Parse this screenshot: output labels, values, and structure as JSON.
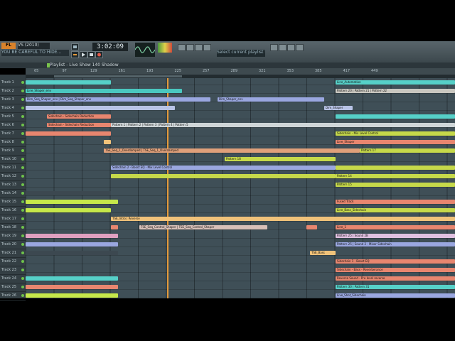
{
  "window": {
    "logo": "FL",
    "preset": "VS (2010)",
    "hint_text": "YOU BE CAREFUL TO HIDE...",
    "tempo_display": "3:02:09",
    "hint_panel": "Select current playlist track",
    "playlist_title": "Playlist - Live Show 140 Shadow"
  },
  "tracks": [
    "Track 1",
    "Track 2",
    "Track 3",
    "Track 4",
    "Track 5",
    "Track 6",
    "Track 7",
    "Track 8",
    "Track 9",
    "Track 10",
    "Track 11",
    "Track 12",
    "Track 13",
    "Track 14",
    "Track 15",
    "Track 16",
    "Track 17",
    "Track 18",
    "Track 19",
    "Track 20",
    "Track 21",
    "Track 22",
    "Track 23",
    "Track 24",
    "Track 25",
    "Track 26"
  ],
  "ruler_bars": [
    "65",
    "97",
    "129",
    "161",
    "193",
    "225",
    "257",
    "289",
    "321",
    "353",
    "385",
    "417",
    "449"
  ],
  "clips": [
    {
      "track": 0,
      "start": 0,
      "end": 120,
      "color": "#56d0c8",
      "label": ""
    },
    {
      "track": 0,
      "start": 436,
      "end": 604,
      "color": "#56d0c8",
      "label": "Line_Automation"
    },
    {
      "track": 1,
      "start": 0,
      "end": 220,
      "color": "#4ac7bf",
      "label": "Line_Shaper_env"
    },
    {
      "track": 1,
      "start": 436,
      "end": 604,
      "color": "#c9c7c0",
      "label": "Pattern 20 | Pattern 21 | Pattern 22"
    },
    {
      "track": 2,
      "start": 0,
      "end": 260,
      "color": "#9aa7e0",
      "label": "Dim_Seq_Shaper_env | Dim_Seq_Shaper_env"
    },
    {
      "track": 2,
      "start": 270,
      "end": 420,
      "color": "#9aa7e0",
      "label": "Dim_Shaper_env"
    },
    {
      "track": 3,
      "start": 0,
      "end": 210,
      "color": "#b8c3e6",
      "label": ""
    },
    {
      "track": 3,
      "start": 420,
      "end": 460,
      "color": "#b8c3e6",
      "label": "Dim_Shaper"
    },
    {
      "track": 4,
      "start": 30,
      "end": 120,
      "color": "#e8866f",
      "label": "Sidechain - Sidechain Reduction"
    },
    {
      "track": 4,
      "start": 436,
      "end": 604,
      "color": "#56d0c8",
      "label": ""
    },
    {
      "track": 5,
      "start": 30,
      "end": 120,
      "color": "#e8866f",
      "label": "Sidechain - Sidechain Reduction"
    },
    {
      "track": 5,
      "start": 120,
      "end": 604,
      "color": "#cfd6d8",
      "label": "Pattern 1 | Pattern 2 | Pattern 3 | Pattern 4 | Pattern 5"
    },
    {
      "track": 6,
      "start": 0,
      "end": 120,
      "color": "#e8866f",
      "label": ""
    },
    {
      "track": 6,
      "start": 436,
      "end": 604,
      "color": "#c6d94a",
      "label": "Sidechain - Mix Level Control"
    },
    {
      "track": 7,
      "start": 110,
      "end": 120,
      "color": "#f0c27a",
      "label": ""
    },
    {
      "track": 7,
      "start": 436,
      "end": 604,
      "color": "#e8866f",
      "label": "Line_Shaper"
    },
    {
      "track": 8,
      "start": 110,
      "end": 470,
      "color": "#e0a07a",
      "label": "TSE_Seq_1_Overdamped | TSE_Seq_1_Overdamped"
    },
    {
      "track": 8,
      "start": 470,
      "end": 604,
      "color": "#c6d94a",
      "label": "Pattern 17"
    },
    {
      "track": 9,
      "start": 280,
      "end": 436,
      "color": "#c6d94a",
      "label": "Pattern 18"
    },
    {
      "track": 10,
      "start": 120,
      "end": 436,
      "color": "#9aa7e0",
      "label": "Sidechain 2 - Boost EQ - Mix Level Control"
    },
    {
      "track": 10,
      "start": 436,
      "end": 604,
      "color": "#c6d94a",
      "label": ""
    },
    {
      "track": 11,
      "start": 120,
      "end": 436,
      "color": "#c6d94a",
      "label": ""
    },
    {
      "track": 11,
      "start": 436,
      "end": 604,
      "color": "#c6d94a",
      "label": "Pattern 14"
    },
    {
      "track": 12,
      "start": 436,
      "end": 604,
      "color": "#c6d94a",
      "label": "Pattern 15"
    },
    {
      "track": 13,
      "start": 0,
      "end": 120,
      "color": "#3c4850",
      "label": ""
    },
    {
      "track": 14,
      "start": 0,
      "end": 130,
      "color": "#c6e84a",
      "label": ""
    },
    {
      "track": 14,
      "start": 436,
      "end": 604,
      "color": "#e8866f",
      "label": "Fused Track"
    },
    {
      "track": 15,
      "start": 0,
      "end": 120,
      "color": "#c6e84a",
      "label": ""
    },
    {
      "track": 15,
      "start": 436,
      "end": 604,
      "color": "#c6d94a",
      "label": "Line_Bass_Sidechain"
    },
    {
      "track": 16,
      "start": 120,
      "end": 604,
      "color": "#f0c27a",
      "label": "TSE_Intro | Reverse"
    },
    {
      "track": 17,
      "start": 120,
      "end": 130,
      "color": "#e8866f",
      "label": ""
    },
    {
      "track": 17,
      "start": 160,
      "end": 340,
      "color": "#d8c0b8",
      "label": "TSE_Seq_Control_Shaper | TSE_Seq_Control_Shaper"
    },
    {
      "track": 17,
      "start": 395,
      "end": 410,
      "color": "#e8866f",
      "label": ""
    },
    {
      "track": 17,
      "start": 436,
      "end": 604,
      "color": "#e8866f",
      "label": "Line_1"
    },
    {
      "track": 18,
      "start": 0,
      "end": 130,
      "color": "#e0a0c0",
      "label": ""
    },
    {
      "track": 18,
      "start": 436,
      "end": 604,
      "color": "#e0c0e0",
      "label": "Pattern 25 | Sound 2B"
    },
    {
      "track": 19,
      "start": 0,
      "end": 130,
      "color": "#9aa7e0",
      "label": ""
    },
    {
      "track": 19,
      "start": 436,
      "end": 604,
      "color": "#9aa7e0",
      "label": "Pattern 25 | Sound 2 - Mixer Sidechain"
    },
    {
      "track": 20,
      "start": 0,
      "end": 130,
      "color": "#3c4850",
      "label": ""
    },
    {
      "track": 20,
      "start": 400,
      "end": 436,
      "color": "#f0c27a",
      "label": "TSE_Bass"
    },
    {
      "track": 21,
      "start": 436,
      "end": 604,
      "color": "#e8866f",
      "label": "Sidechain 1 - Boost EQ"
    },
    {
      "track": 22,
      "start": 436,
      "end": 604,
      "color": "#e8866f",
      "label": "Sidechain - Bass - Reverberance"
    },
    {
      "track": 23,
      "start": 0,
      "end": 130,
      "color": "#56d0c8",
      "label": ""
    },
    {
      "track": 23,
      "start": 436,
      "end": 604,
      "color": "#e8866f",
      "label": "Reverse Sound - Pre level reverse"
    },
    {
      "track": 24,
      "start": 0,
      "end": 130,
      "color": "#e8866f",
      "label": ""
    },
    {
      "track": 24,
      "start": 436,
      "end": 604,
      "color": "#56d0c8",
      "label": "Pattern 30 | Pattern 31"
    },
    {
      "track": 25,
      "start": 0,
      "end": 130,
      "color": "#c6e84a",
      "label": ""
    },
    {
      "track": 25,
      "start": 436,
      "end": 604,
      "color": "#9aa7e0",
      "label": "Live_Shot_Sidechain"
    }
  ]
}
